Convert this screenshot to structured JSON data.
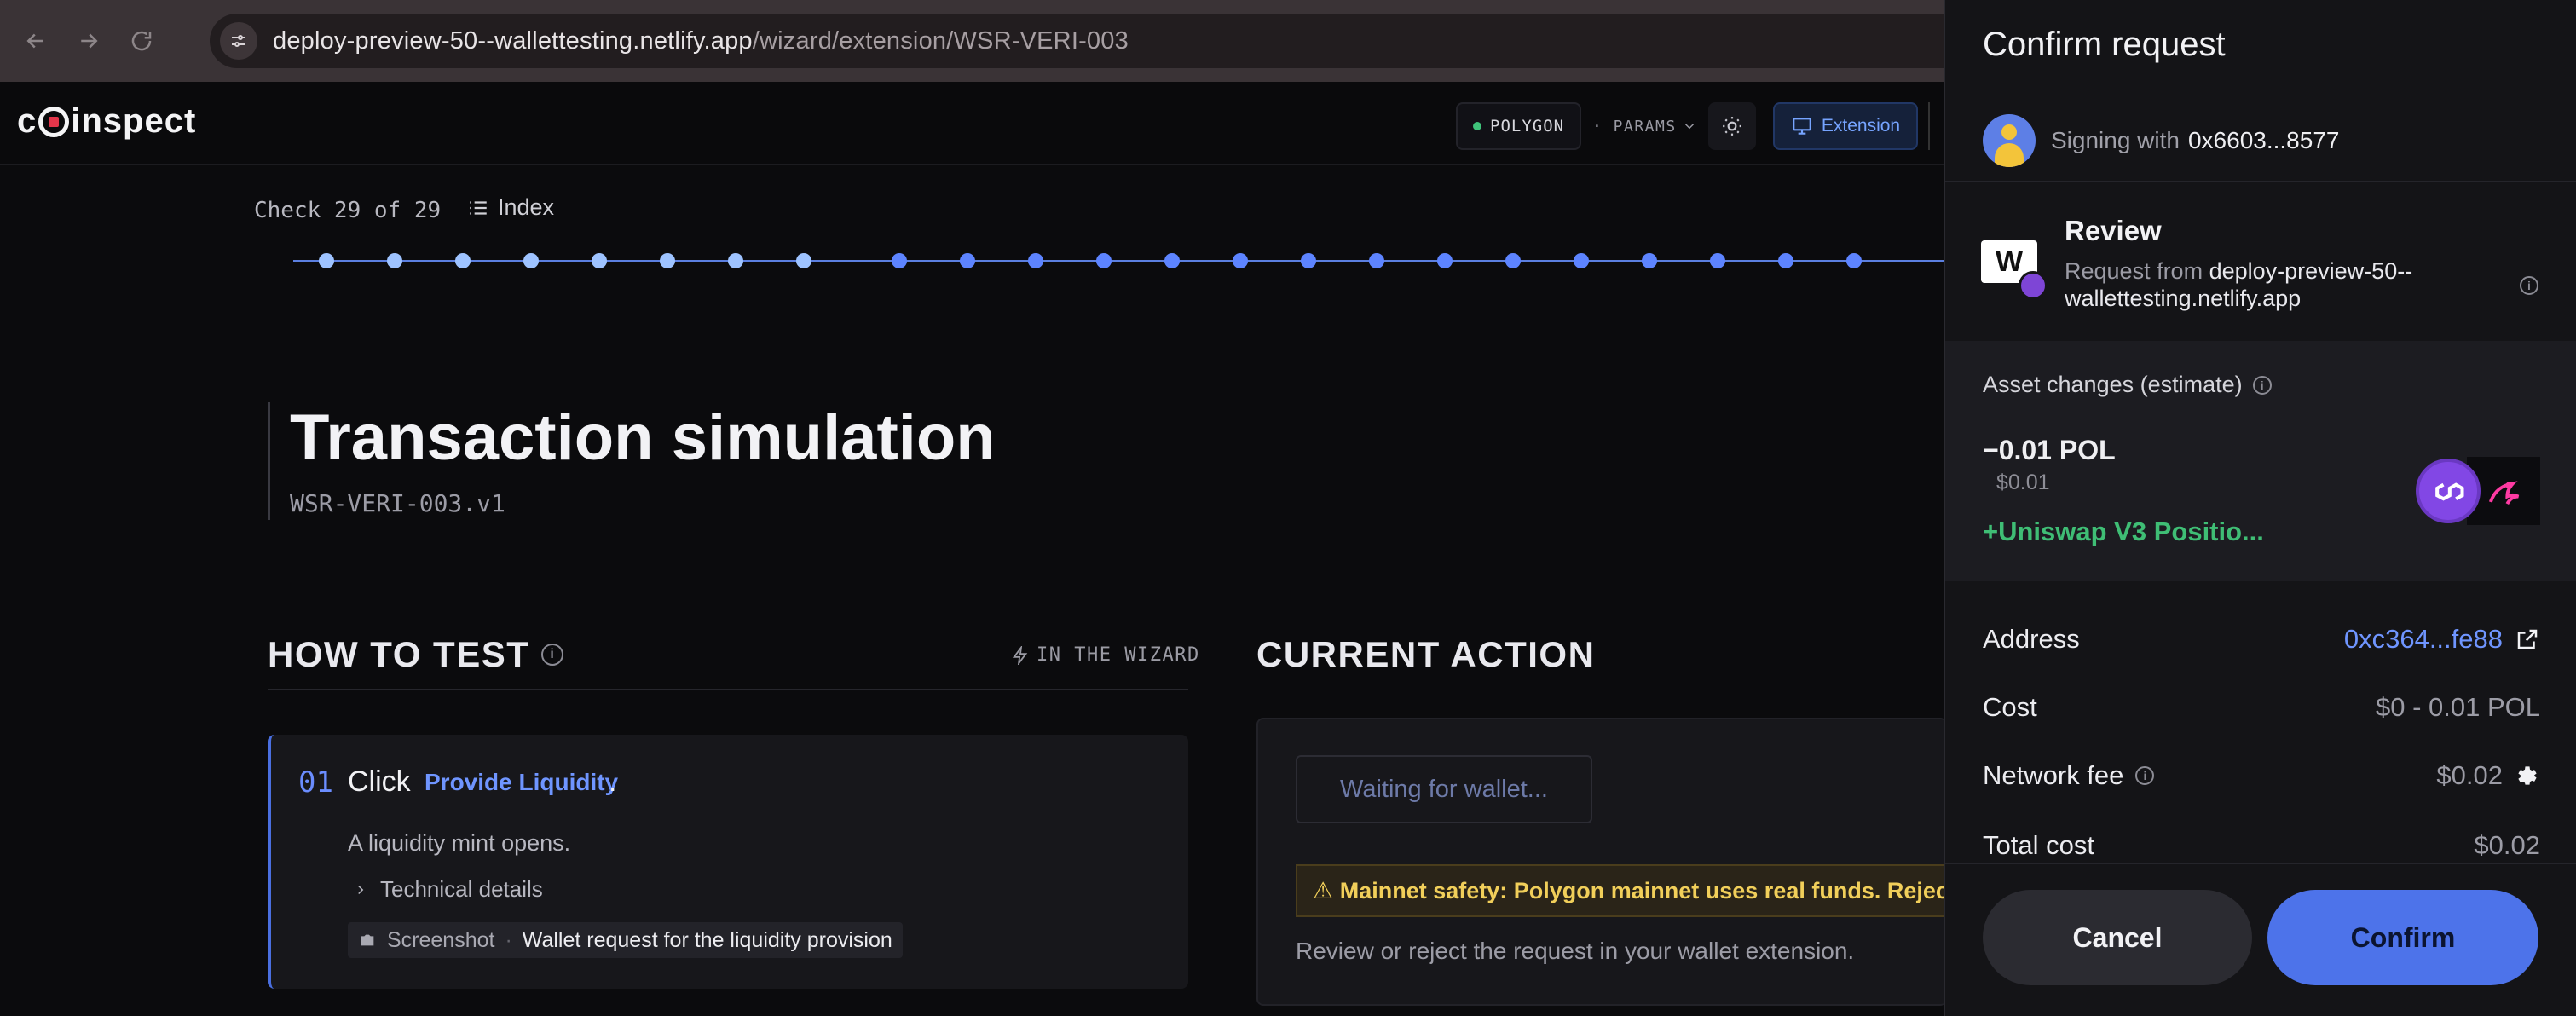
{
  "browser": {
    "url_host": "deploy-preview-50--wallettesting.netlify.app",
    "url_path": "/wizard/extension/WSR-VERI-003"
  },
  "header": {
    "logo_text": "coinspect",
    "network": "POLYGON",
    "params_label": "· PARAMS",
    "extension_label": "Extension"
  },
  "progress": {
    "check_label": "Check 29 of 29",
    "index_label": "Index",
    "done_color": "#9ec3ff",
    "pending_color": "#5d84ff"
  },
  "page": {
    "title": "Transaction simulation",
    "subtitle": "WSR-VERI-003.v1"
  },
  "how_to_test": {
    "heading": "HOW TO TEST",
    "tag": "IN THE WIZARD",
    "step": {
      "number": "01",
      "verb": "Click",
      "link": "Provide Liquidity",
      "punct": ".",
      "description": "A liquidity mint opens.",
      "tech_details": "Technical details",
      "screenshot_label": "Screenshot",
      "screenshot_sep": "·",
      "screenshot_value": "Wallet request for the liquidity provision"
    }
  },
  "current_action": {
    "heading": "CURRENT ACTION",
    "wait_button": "Waiting for wallet...",
    "safety_text": "⚠ Mainnet safety: Polygon mainnet uses real funds. Reject",
    "hint": "Review or reject the request in your wallet extension."
  },
  "wallet": {
    "title": "Confirm request",
    "signing_prefix": "Signing with",
    "signing_address": "0x6603...8577",
    "review_title": "Review",
    "request_from_prefix": "Request from",
    "request_host": "deploy-preview-50--wallettesting.netlify.app",
    "asset_changes_title": "Asset changes (estimate)",
    "asset_out": "−0.01 POL",
    "asset_out_usd": "$0.01",
    "asset_in": "+Uniswap V3 Positio...",
    "rows": [
      {
        "key": "Address",
        "value": "0xc364...fe88"
      },
      {
        "key": "Cost",
        "value": "$0 - 0.01 POL"
      },
      {
        "key": "Network fee",
        "value": "$0.02"
      },
      {
        "key": "Total cost",
        "value": "$0.02"
      }
    ],
    "cancel": "Cancel",
    "confirm": "Confirm",
    "accent": "#4d73ea"
  }
}
